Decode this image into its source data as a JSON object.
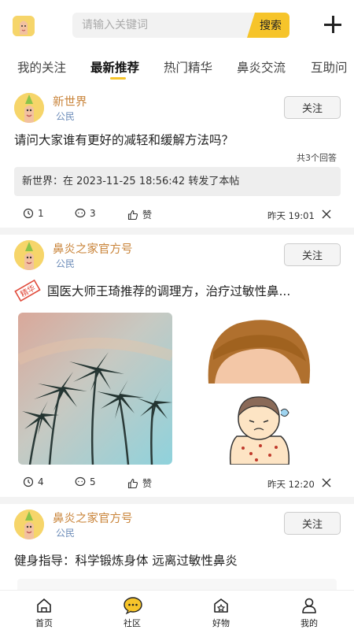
{
  "header": {
    "search_placeholder": "请输入关键词",
    "search_button": "搜索"
  },
  "tabs": [
    {
      "label": "我的关注",
      "active": false
    },
    {
      "label": "最新推荐",
      "active": true
    },
    {
      "label": "热门精华",
      "active": false
    },
    {
      "label": "鼻炎交流",
      "active": false
    },
    {
      "label": "互助问",
      "active": false
    }
  ],
  "posts": [
    {
      "author": "新世界",
      "role": "公民",
      "follow_label": "关注",
      "title": "请问大家谁有更好的减轻和缓解方法吗？",
      "reply_count": "共3个回答",
      "forward_text": "新世界：在 2023-11-25 18:56:42 转发了本帖",
      "views": "1",
      "comments": "3",
      "like_label": "赞",
      "time": "昨天 19:01"
    },
    {
      "author": "鼻炎之家官方号",
      "role": "公民",
      "follow_label": "关注",
      "badge": "精华",
      "title": "国医大师王琦推荐的调理方，治疗过敏性鼻...",
      "views": "4",
      "comments": "5",
      "like_label": "赞",
      "time": "昨天 12:20"
    },
    {
      "author": "鼻炎之家官方号",
      "role": "公民",
      "follow_label": "关注",
      "title": "健身指导：科学锻炼身体 远离过敏性鼻炎"
    }
  ],
  "bottom_nav": [
    {
      "label": "首页",
      "icon": "home-icon"
    },
    {
      "label": "社区",
      "icon": "community-icon",
      "active": true
    },
    {
      "label": "好物",
      "icon": "goods-icon"
    },
    {
      "label": "我的",
      "icon": "profile-icon"
    }
  ],
  "colors": {
    "accent": "#f6c42a",
    "author": "#c9843a",
    "role": "#6b8bb8"
  }
}
